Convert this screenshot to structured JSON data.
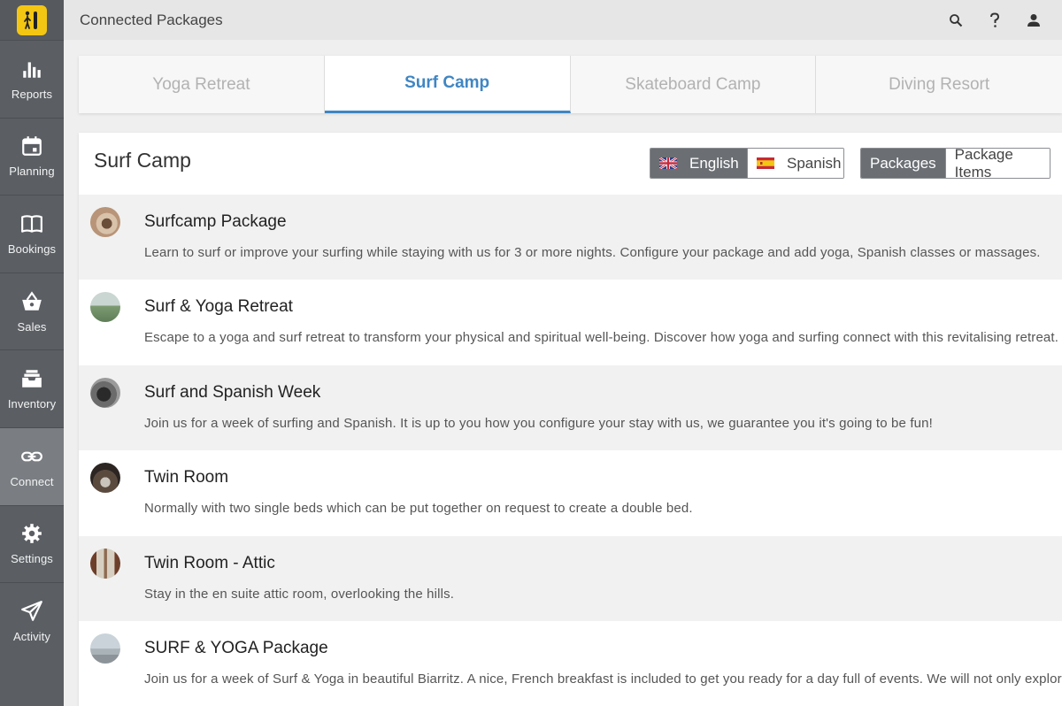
{
  "header": {
    "title": "Connected Packages"
  },
  "sidebar": {
    "items": [
      {
        "label": "Reports",
        "icon": "bar-chart-icon"
      },
      {
        "label": "Planning",
        "icon": "calendar-icon"
      },
      {
        "label": "Bookings",
        "icon": "book-icon"
      },
      {
        "label": "Sales",
        "icon": "basket-icon"
      },
      {
        "label": "Inventory",
        "icon": "inbox-icon"
      },
      {
        "label": "Connect",
        "icon": "link-icon",
        "active": true
      },
      {
        "label": "Settings",
        "icon": "gear-icon"
      },
      {
        "label": "Activity",
        "icon": "paper-plane-icon"
      }
    ]
  },
  "tabs": [
    {
      "label": "Yoga Retreat"
    },
    {
      "label": "Surf Camp",
      "active": true
    },
    {
      "label": "Skateboard Camp"
    },
    {
      "label": "Diving Resort"
    }
  ],
  "panel": {
    "title": "Surf Camp",
    "languages": [
      {
        "label": "English",
        "selected": true
      },
      {
        "label": "Spanish"
      }
    ],
    "views": [
      {
        "label": "Packages",
        "selected": true
      },
      {
        "label": "Package Items"
      }
    ]
  },
  "packages": [
    {
      "title": "Surfcamp Package",
      "description": "Learn to surf or improve your surfing while staying with us for 3 or more nights. Configure your package and add yoga, Spanish classes or massages."
    },
    {
      "title": "Surf & Yoga Retreat",
      "description": "Escape to a yoga and surf retreat to transform your physical and spiritual well-being. Discover how yoga and surfing connect with this revitalising retreat."
    },
    {
      "title": "Surf and Spanish Week",
      "description": "Join us for a week of surfing and Spanish. It is up to you how you configure your stay with us, we guarantee you it's going to be fun!"
    },
    {
      "title": "Twin Room",
      "description": "Normally with two single beds which can be put together on request to create a double bed."
    },
    {
      "title": "Twin Room - Attic",
      "description": "Stay in the en suite attic room, overlooking the hills."
    },
    {
      "title": "SURF & YOGA Package",
      "description": "Join us for a week of Surf & Yoga in beautiful Biarritz. A nice, French breakfast is included to get you ready for a day full of events. We will not only explore the"
    }
  ],
  "colors": {
    "accent": "#3f86c3",
    "sidebar": "#5b5f64",
    "sidebar_active": "#7a7e83",
    "logo": "#f3c613"
  }
}
